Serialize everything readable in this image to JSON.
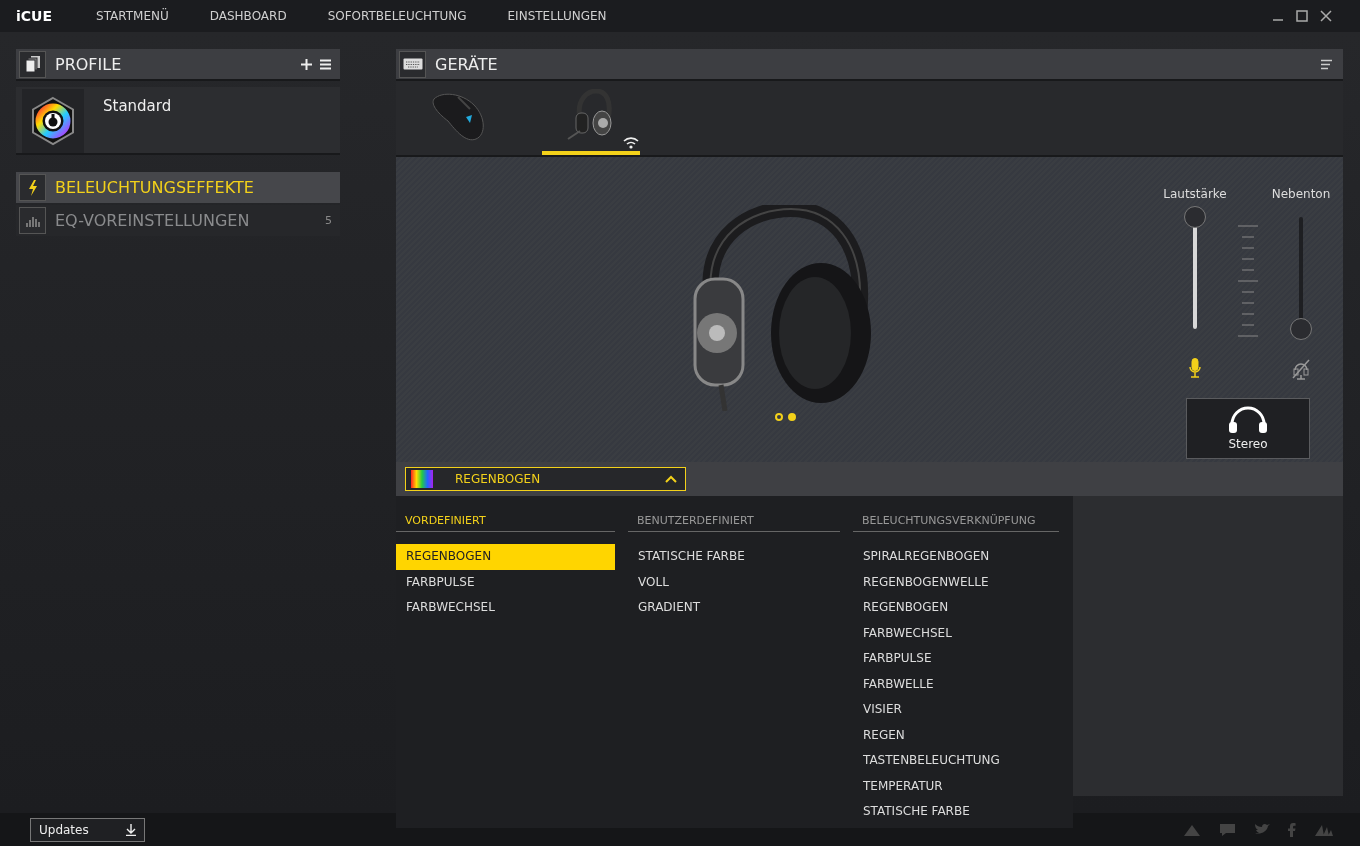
{
  "app": {
    "logo": "iCUE"
  },
  "nav": [
    {
      "label": "STARTMENÜ"
    },
    {
      "label": "DASHBOARD"
    },
    {
      "label": "SOFORTBELEUCHTUNG"
    },
    {
      "label": "EINSTELLUNGEN"
    }
  ],
  "profiles": {
    "title": "PROFILE",
    "items": [
      {
        "name": "Standard"
      }
    ]
  },
  "sections": [
    {
      "kind": "lighting",
      "label": "BELEUCHTUNGSEFFEKTE",
      "selected": true
    },
    {
      "kind": "eq",
      "label": "EQ-VOREINSTELLUNGEN",
      "selected": false,
      "count": "5"
    }
  ],
  "devices": {
    "title": "GERÄTE",
    "items": [
      {
        "kind": "mouse",
        "selected": false,
        "wireless": false
      },
      {
        "kind": "headset",
        "selected": true,
        "wireless": true
      }
    ]
  },
  "carousel": [
    {
      "selected": false
    },
    {
      "selected": true
    }
  ],
  "sliders": [
    {
      "kind": "volume",
      "label": "Lautstärke",
      "level": 1,
      "muted": false
    },
    {
      "kind": "sidetone",
      "label": "Nebenton",
      "level": 0,
      "muted": true
    }
  ],
  "mode_button": {
    "label": "Stereo"
  },
  "effect_select": {
    "value": "REGENBOGEN",
    "expanded": true
  },
  "effect_groups": [
    {
      "title": "VORDEFINIERT",
      "selected": true,
      "items": [
        {
          "label": "REGENBOGEN",
          "selected": true
        },
        {
          "label": "FARBPULSE",
          "selected": false
        },
        {
          "label": "FARBWECHSEL",
          "selected": false
        }
      ]
    },
    {
      "title": "BENUTZERDEFINIERT",
      "selected": false,
      "items": [
        {
          "label": "STATISCHE FARBE",
          "selected": false
        },
        {
          "label": "VOLL",
          "selected": false
        },
        {
          "label": "GRADIENT",
          "selected": false
        }
      ]
    },
    {
      "title": "BELEUCHTUNGSVERKNÜPFUNG",
      "selected": false,
      "items": [
        {
          "label": "SPIRALREGENBOGEN",
          "selected": false
        },
        {
          "label": "REGENBOGENWELLE",
          "selected": false
        },
        {
          "label": "REGENBOGEN",
          "selected": false
        },
        {
          "label": "FARBWECHSEL",
          "selected": false
        },
        {
          "label": "FARBPULSE",
          "selected": false
        },
        {
          "label": "FARBWELLE",
          "selected": false
        },
        {
          "label": "VISIER",
          "selected": false
        },
        {
          "label": "REGEN",
          "selected": false
        },
        {
          "label": "TASTENBELEUCHTUNG",
          "selected": false
        },
        {
          "label": "TEMPERATUR",
          "selected": false
        },
        {
          "label": "STATISCHE FARBE",
          "selected": false
        }
      ]
    }
  ],
  "footer": {
    "updates": "Updates"
  }
}
